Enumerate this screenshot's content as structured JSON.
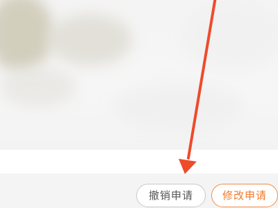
{
  "actions": {
    "cancel_label": "撤销申请",
    "modify_label": "修改申请"
  },
  "colors": {
    "accent": "#f07a2e",
    "annotation_arrow": "#ee4b2b"
  },
  "icons": {
    "annotation": "arrow-down-annotation"
  }
}
